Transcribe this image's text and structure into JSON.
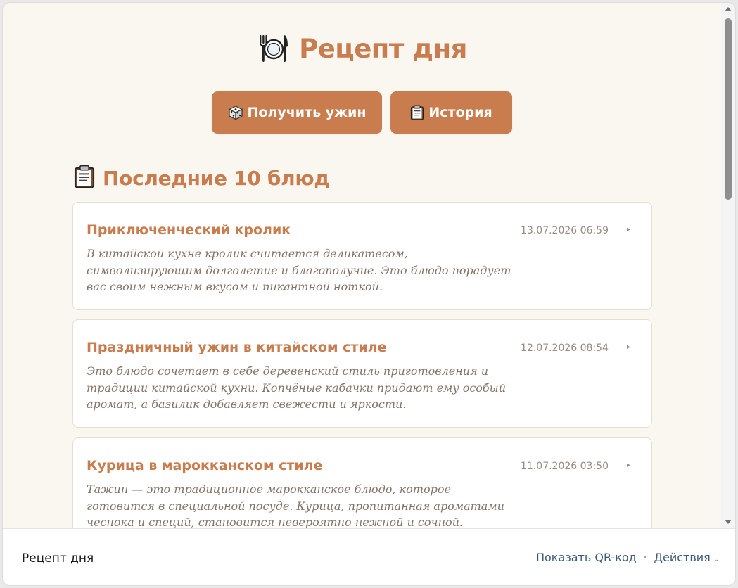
{
  "app": {
    "title": "Рецепт дня",
    "title_icon": "fork-plate-knife-icon"
  },
  "buttons": {
    "dinner": {
      "icon": "dice-icon",
      "label": "Получить ужин"
    },
    "history": {
      "icon": "clipboard-icon",
      "label": "История"
    }
  },
  "history_section": {
    "icon": "clipboard-icon",
    "title": "Последние 10 блюд",
    "items": [
      {
        "title": "Приключенческий кролик",
        "description": "В китайской кухне кролик считается деликатесом, символизирующим долголетие и благополучие. Это блюдо порадует вас своим нежным вкусом и пикантной ноткой.",
        "date": "13.07.2026 06:59",
        "arrow": "▸"
      },
      {
        "title": "Праздничный ужин в китайском стиле",
        "description": "Это блюдо сочетает в себе деревенский стиль приготовления и традиции китайской кухни. Копчёные кабачки придают ему особый аромат, а базилик добавляет свежести и яркости.",
        "date": "12.07.2026 08:54",
        "arrow": "▸"
      },
      {
        "title": "Курица в марокканском стиле",
        "description": "Тажин — это традиционное марокканское блюдо, которое готовится в специальной посуде. Курица, пропитанная ароматами чеснока и специй, становится невероятно нежной и сочной.",
        "date": "11.07.2026 03:50",
        "arrow": "▸"
      }
    ]
  },
  "footer": {
    "app_name": "Рецепт дня",
    "qr_link": "Показать QR-код",
    "separator": "•",
    "actions_label": "Действия",
    "actions_chevron": "⌄"
  },
  "colors": {
    "accent": "#c97c4e",
    "background": "#faf6f0",
    "card_border": "#e8ddd2",
    "muted_text": "#857366",
    "link": "#3c5a78"
  }
}
